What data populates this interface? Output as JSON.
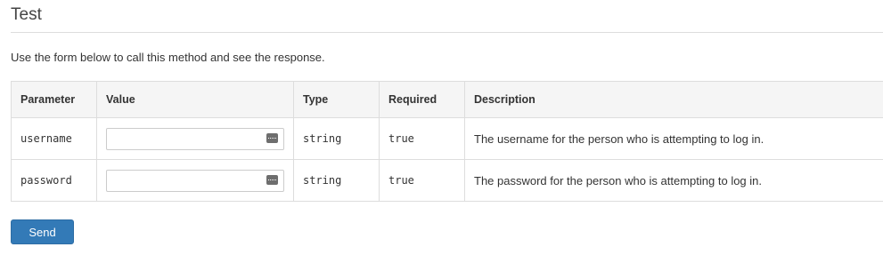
{
  "section": {
    "title": "Test",
    "intro": "Use the form below to call this method and see the response."
  },
  "table": {
    "headers": {
      "parameter": "Parameter",
      "value": "Value",
      "type": "Type",
      "required": "Required",
      "description": "Description"
    },
    "rows": [
      {
        "parameter": "username",
        "value": "",
        "type": "string",
        "required": "true",
        "description": "The username for the person who is attempting to log in."
      },
      {
        "parameter": "password",
        "value": "",
        "type": "string",
        "required": "true",
        "description": "The password for the person who is attempting to log in."
      }
    ]
  },
  "actions": {
    "send_label": "Send"
  },
  "icons": {
    "input_icon": "password-manager-key-icon"
  },
  "colors": {
    "primary_button": "#337ab7",
    "header_background": "#f5f5f5",
    "border": "#dddddd"
  }
}
